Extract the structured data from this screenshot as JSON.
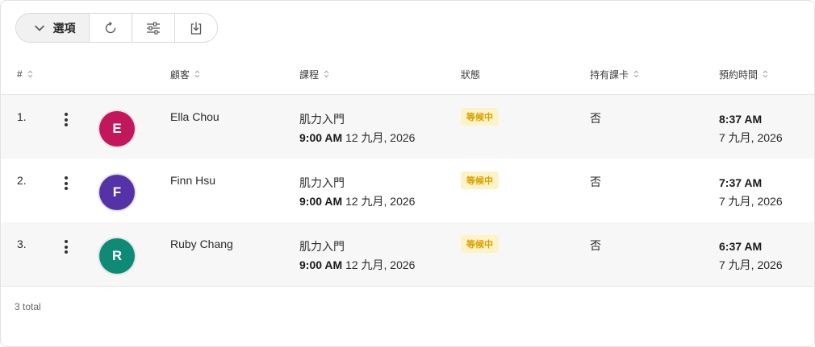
{
  "toolbar": {
    "options_label": "選項",
    "icons": [
      "chevron-down-icon",
      "refresh-icon",
      "sliders-icon",
      "download-icon"
    ]
  },
  "columns": {
    "index": "#",
    "customer": "顧客",
    "course": "課程",
    "status": "狀態",
    "card": "持有課卡",
    "booked_at": "預約時間"
  },
  "rows": [
    {
      "index": "1.",
      "initial": "E",
      "avatar_color": "#c2185b",
      "name": "Ella Chou",
      "course_name": "肌力入門",
      "course_time": "9:00 AM",
      "course_date": "12 九月, 2026",
      "status": "等候中",
      "has_card": "否",
      "booked_time": "8:37 AM",
      "booked_date": "7 九月, 2026"
    },
    {
      "index": "2.",
      "initial": "F",
      "avatar_color": "#5632a8",
      "name": "Finn Hsu",
      "course_name": "肌力入門",
      "course_time": "9:00 AM",
      "course_date": "12 九月, 2026",
      "status": "等候中",
      "has_card": "否",
      "booked_time": "7:37 AM",
      "booked_date": "7 九月, 2026"
    },
    {
      "index": "3.",
      "initial": "R",
      "avatar_color": "#0e8a76",
      "name": "Ruby Chang",
      "course_name": "肌力入門",
      "course_time": "9:00 AM",
      "course_date": "12 九月, 2026",
      "status": "等候中",
      "has_card": "否",
      "booked_time": "6:37 AM",
      "booked_date": "7 九月, 2026"
    }
  ],
  "footer": {
    "total": "3 total"
  },
  "colors": {
    "status_bg": "#fdf3c8",
    "status_text": "#d6a000",
    "row_alt": "#f7f7f7"
  }
}
